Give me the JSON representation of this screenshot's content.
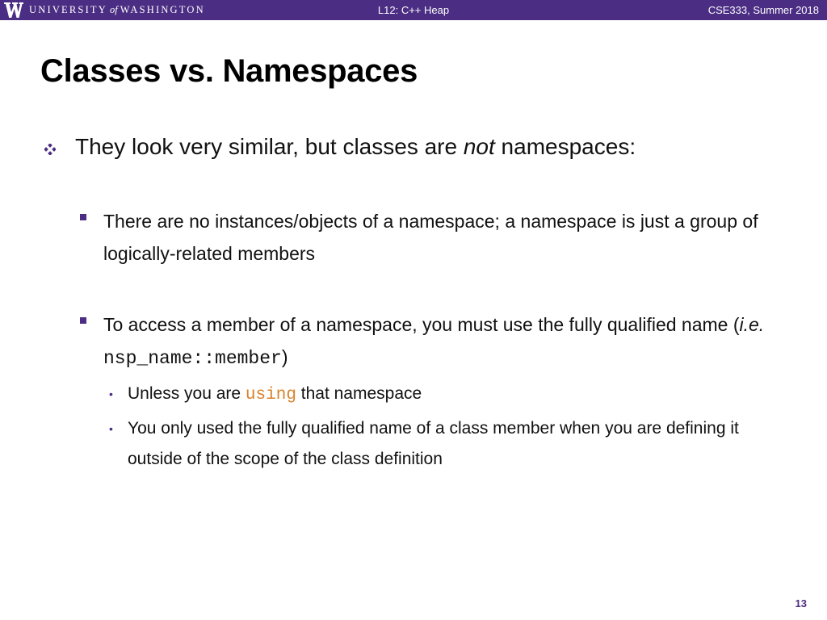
{
  "header": {
    "university_part1": "UNIVERSITY",
    "university_of": "of",
    "university_part2": "WASHINGTON",
    "lecture": "L12: C++ Heap",
    "course": "CSE333, Summer 2018"
  },
  "slide": {
    "title": "Classes vs. Namespaces",
    "bullet1": {
      "before": "They look very similar, but classes are ",
      "emph": "not",
      "after": " namespaces:"
    },
    "sub1": {
      "text": "There are no instances/objects of a namespace; a namespace is just a group of logically-related members"
    },
    "sub2": {
      "before": "To access a member of a namespace, you must use the fully qualified name (",
      "emph": "i.e.",
      "code": "nsp_name::member",
      "after": ")"
    },
    "sub2a": {
      "before": "Unless you are ",
      "keyword": "using",
      "after": " that namespace"
    },
    "sub2b": {
      "text": "You only used the fully qualified name of a class member when you are defining it outside of the scope of the class definition"
    },
    "page_number": "13"
  },
  "colors": {
    "header_purple": "#4b2e83",
    "keyword_orange": "#d9822b"
  }
}
